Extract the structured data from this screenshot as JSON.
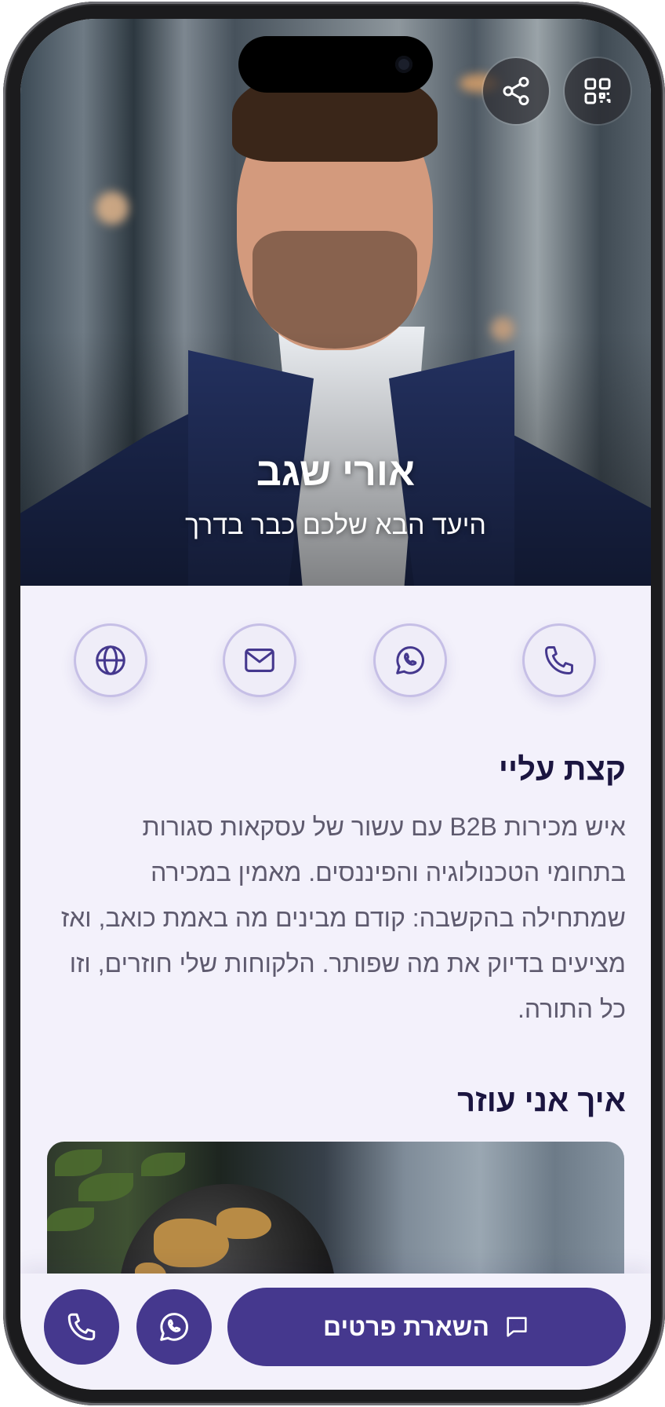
{
  "profile": {
    "name": "אורי שגב",
    "tagline": "היעד הבא שלכם כבר בדרך"
  },
  "header_actions": [
    {
      "icon": "share-icon"
    },
    {
      "icon": "qr-code-icon"
    }
  ],
  "contact_buttons": [
    {
      "icon": "phone-icon"
    },
    {
      "icon": "whatsapp-icon"
    },
    {
      "icon": "mail-icon"
    },
    {
      "icon": "globe-icon"
    }
  ],
  "about": {
    "title": "קצת עליי",
    "text": "איש מכירות B2B עם עשור של עסקאות סגורות בתחומי הטכנולוגיה והפיננסים. מאמין במכירה שמתחילה בהקשבה: קודם מבינים מה באמת כואב, ואז מציעים בדיוק את מה שפותר. הלקוחות שלי חוזרים, וזו כל התורה."
  },
  "help": {
    "title": "איך אני עוזר"
  },
  "bottom_bar": {
    "cta_label": "השארת פרטים",
    "cta_icon": "message-icon",
    "whatsapp_icon": "whatsapp-icon",
    "phone_icon": "phone-icon"
  },
  "colors": {
    "accent": "#45388e",
    "background": "#f3f1fb",
    "heading": "#1b1540",
    "body_text": "#5e5a6e"
  }
}
